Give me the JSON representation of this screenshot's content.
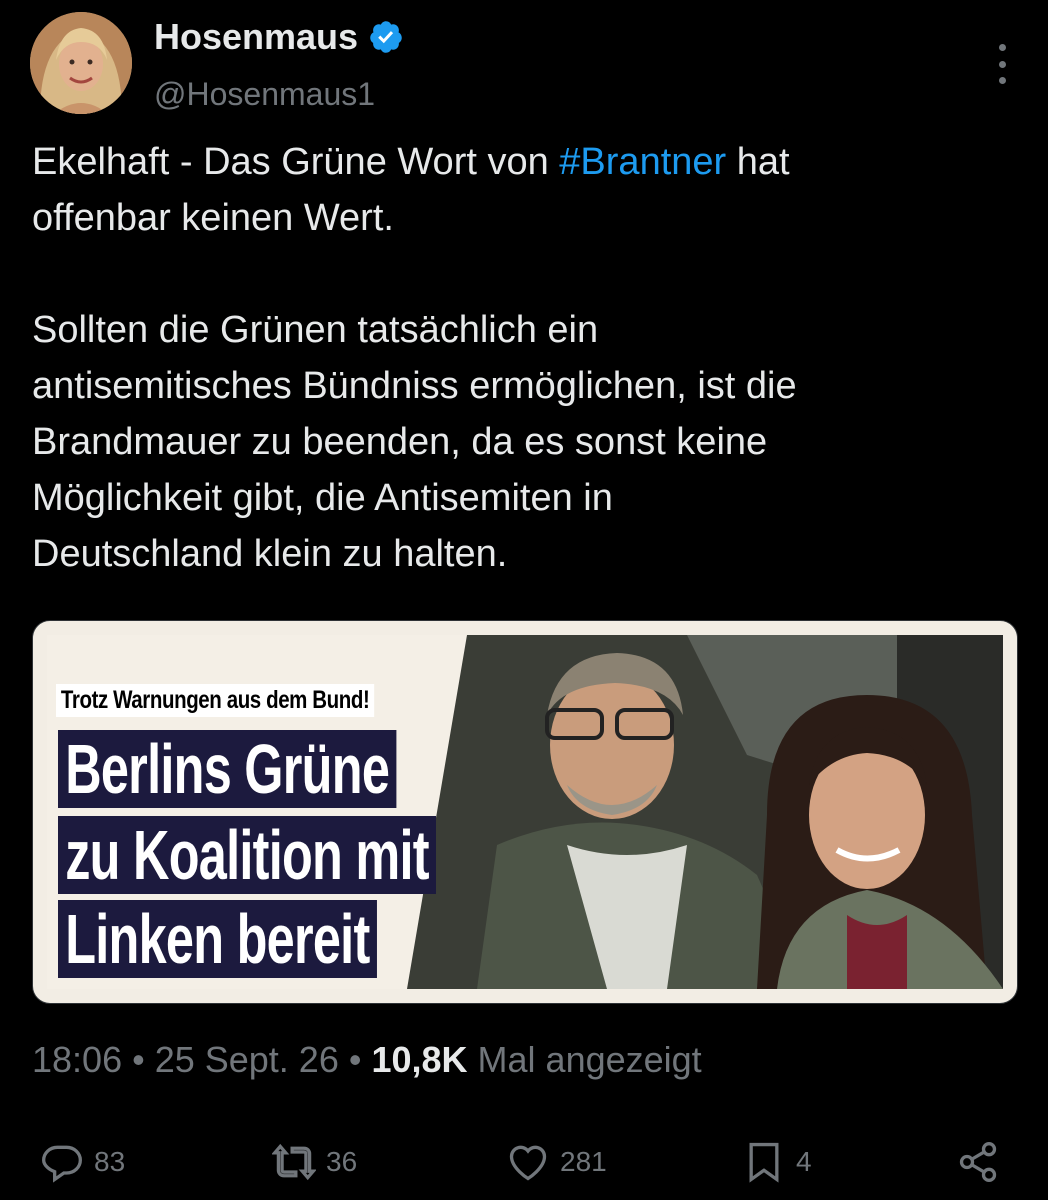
{
  "author": {
    "name": "Hosenmaus",
    "handle": "@Hosenmaus1"
  },
  "tweet": {
    "line1_pre": "Ekelhaft - Das Grüne Wort von ",
    "hashtag": "#Brantner",
    "line1_post": " hat",
    "line2": "offenbar keinen Wert.",
    "para2": [
      "Sollten die Grünen tatsächlich ein",
      "antisemitisches Bündniss ermöglichen, ist die",
      "Brandmauer zu beenden, da es sonst keine",
      "Möglichkeit gibt, die Antisemiten in",
      "Deutschland klein zu halten."
    ]
  },
  "media": {
    "kicker": "Trotz Warnungen aus dem Bund!",
    "headline": [
      "Berlins Grüne",
      "zu Koalition mit",
      "Linken bereit"
    ]
  },
  "meta": {
    "time": "18:06",
    "sep1": " • ",
    "date": "25 Sept. 26",
    "sep2": " • ",
    "views": "10,8K",
    "views_label": " Mal angezeigt"
  },
  "actions": {
    "replies": "83",
    "reposts": "36",
    "likes": "281",
    "bookmarks": "4"
  },
  "colors": {
    "background": "#000000",
    "text": "#e7e9ea",
    "secondary": "#71767b",
    "hashtag": "#1d9bf0",
    "verified": "#1d9bf0"
  }
}
